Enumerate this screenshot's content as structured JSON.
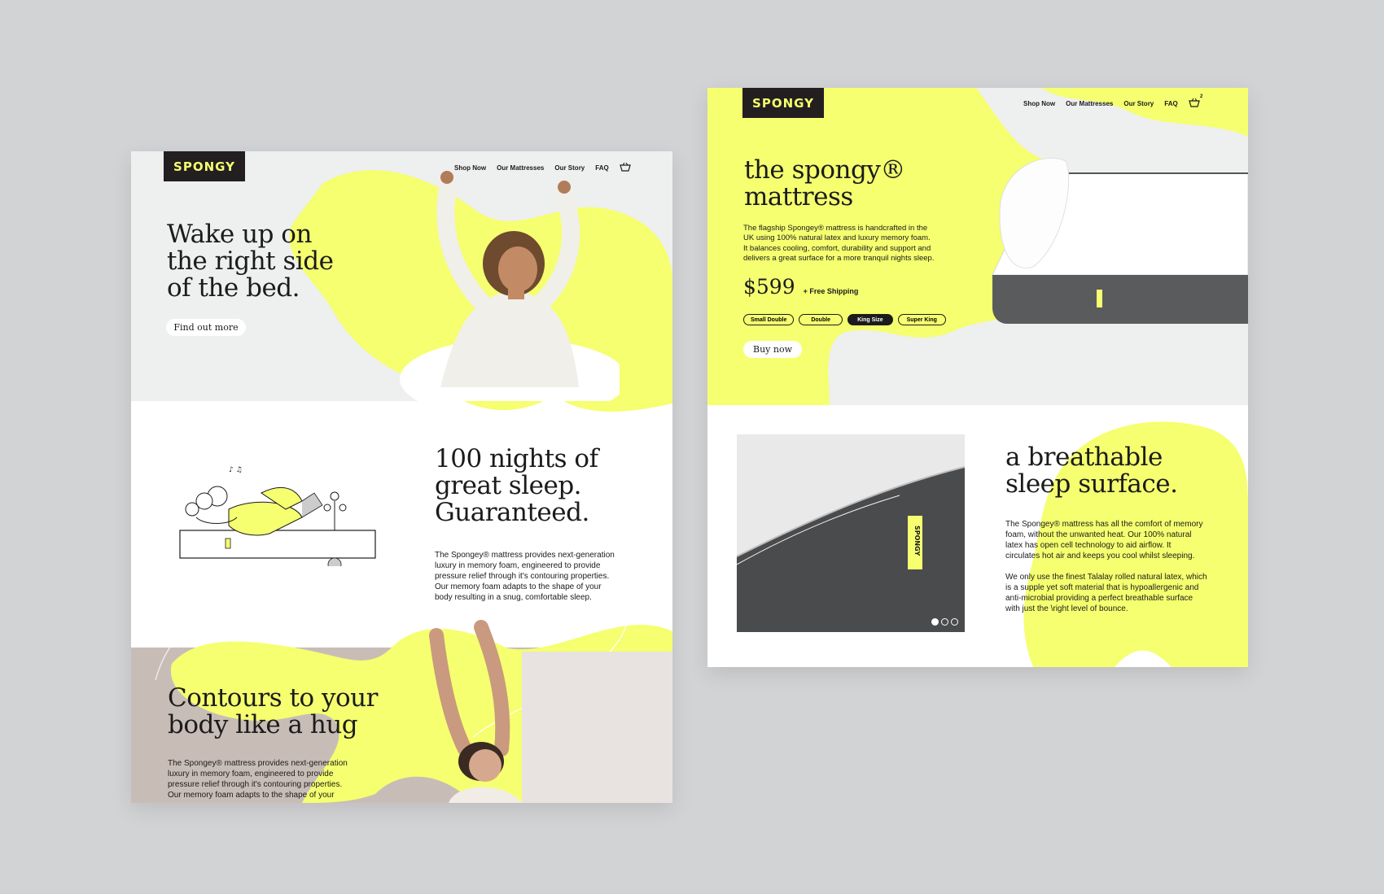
{
  "left_page": {
    "logo": "SPONGY",
    "nav": [
      "Shop Now",
      "Our Mattresses",
      "Our Story",
      "FAQ"
    ],
    "hero": {
      "heading": [
        "Wake up on",
        "the right side",
        "of the bed."
      ],
      "button": "Find out more"
    },
    "nights": {
      "heading": [
        "100 nights of",
        "great sleep.",
        "Guaranteed."
      ],
      "body": [
        "The Spongey® mattress provides next-generation",
        "luxury in memory foam, engineered to provide",
        "pressure relief through it's contouring properties.",
        "Our memory foam adapts to the shape of your",
        "body resulting in a snug, comfortable sleep."
      ]
    },
    "contours": {
      "heading": [
        "Contours to your",
        "body like a hug"
      ],
      "body": [
        "The Spongey® mattress provides next-generation",
        "luxury in memory foam, engineered to provide",
        "pressure relief through it's contouring properties.",
        "Our memory foam adapts to the shape of your"
      ]
    }
  },
  "right_page": {
    "logo": "SPONGY",
    "nav": [
      "Shop Now",
      "Our Mattresses",
      "Our Story",
      "FAQ"
    ],
    "cart_count": "2",
    "product": {
      "heading": [
        "the spongy®",
        "mattress"
      ],
      "description": [
        "The flagship Spongey® mattress is handcrafted in the",
        "UK using 100% natural latex and luxury memory foam.",
        "It balances cooling, comfort, durability and support and",
        "delivers a great surface for a more tranquil nights sleep."
      ],
      "price": "$599",
      "shipping": "+ Free Shipping",
      "sizes": [
        "Small Double",
        "Double",
        "King Size",
        "Super King"
      ],
      "selected_size": "King Size",
      "buy_button": "Buy now",
      "label_tag": "SPONGY"
    },
    "breathable": {
      "heading": [
        "a breathable",
        "sleep surface."
      ],
      "para1": [
        "The Spongey® mattress has all the comfort of memory",
        "foam, without the unwanted heat. Our 100% natural",
        "latex has open cell technology to aid airflow. It",
        "circulates hot air and keeps you cool whilst sleeping."
      ],
      "para2": [
        "We only use the finest Talalay rolled natural latex, which",
        "is a supple yet soft material that is hypoallergenic and",
        "anti-microbial providing a perfect breathable surface",
        "with just the \\right level of bounce."
      ],
      "carousel_dots": 3,
      "active_dot": 1
    }
  },
  "colors": {
    "background": "#d2d3d5",
    "accent_yellow": "#f5ff6f",
    "logo_bg": "#231f20",
    "light_grey": "#eeefef",
    "taupe": "#c8bdb6"
  }
}
